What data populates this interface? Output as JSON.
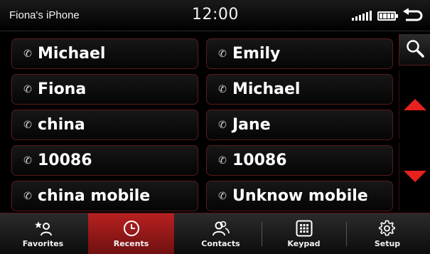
{
  "status": {
    "device_name": "Fiona's iPhone",
    "time": "12:00"
  },
  "contacts": [
    {
      "name": "Michael"
    },
    {
      "name": "Emily"
    },
    {
      "name": "Fiona"
    },
    {
      "name": "Michael"
    },
    {
      "name": "china"
    },
    {
      "name": "Jane"
    },
    {
      "name": "10086"
    },
    {
      "name": "10086"
    },
    {
      "name": "china mobile"
    },
    {
      "name": "Unknow mobile"
    }
  ],
  "tabs": [
    {
      "label": "Favorites",
      "icon": "star-person-icon",
      "active": false
    },
    {
      "label": "Recents",
      "icon": "clock-icon",
      "active": true
    },
    {
      "label": "Contacts",
      "icon": "people-icon",
      "active": false
    },
    {
      "label": "Keypad",
      "icon": "keypad-icon",
      "active": false
    },
    {
      "label": "Setup",
      "icon": "gear-icon",
      "active": false
    }
  ],
  "colors": {
    "accent_red": "#e8211f",
    "active_tab": "#b82020",
    "border_red": "#5b1a1a"
  }
}
